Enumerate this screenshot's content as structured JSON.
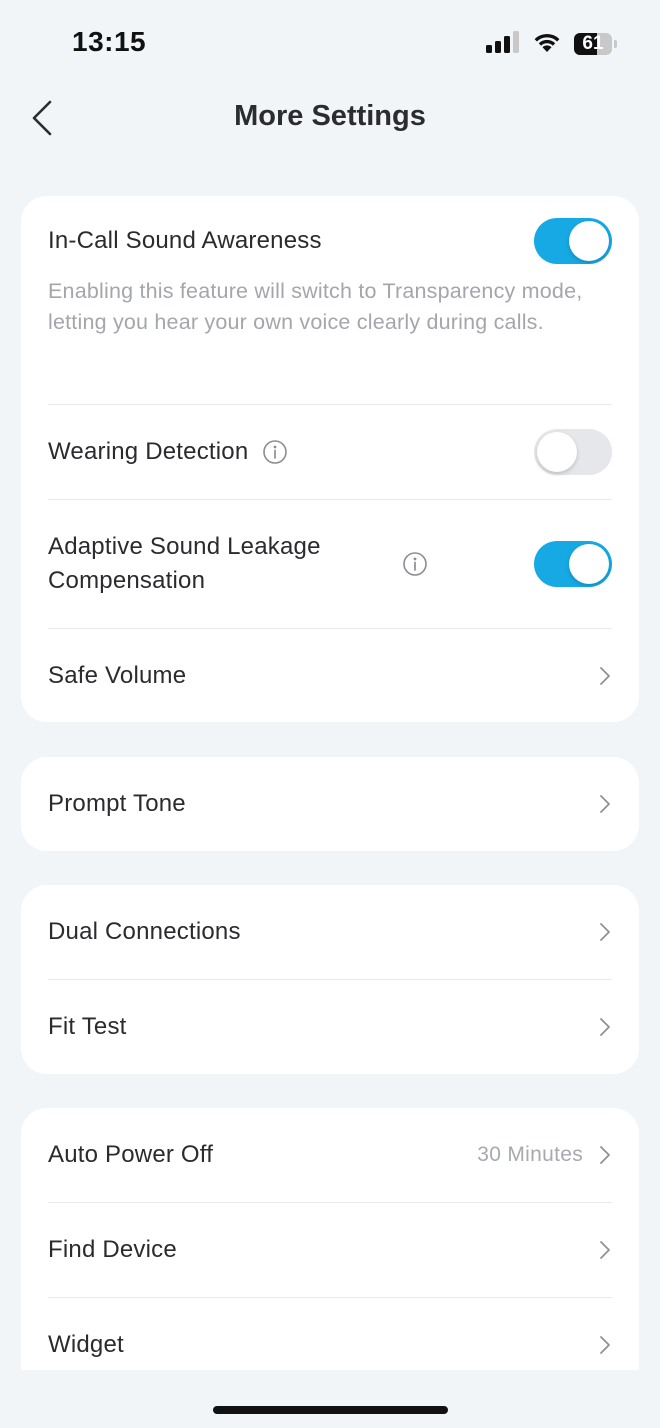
{
  "status_bar": {
    "time": "13:15",
    "battery_level": "61",
    "battery_fraction": 0.61
  },
  "nav": {
    "title": "More Settings"
  },
  "colors": {
    "accent": "#16a9e4",
    "background": "#f2f5f8",
    "card": "#ffffff",
    "secondary_text": "#a3a6ab"
  },
  "card1": {
    "in_call": {
      "label": "In-Call Sound Awareness",
      "description": "Enabling this feature will switch to Transparency mode, letting you hear your own voice clearly during calls.",
      "enabled": true
    },
    "wearing_detection": {
      "label": "Wearing Detection",
      "enabled": false,
      "icon": "info-icon"
    },
    "adaptive_leakage": {
      "label": "Adaptive Sound Leakage Compensation",
      "enabled": true,
      "icon": "info-icon"
    },
    "safe_volume": {
      "label": "Safe Volume"
    }
  },
  "card2": {
    "prompt_tone": {
      "label": "Prompt Tone"
    }
  },
  "card3": {
    "dual_connections": {
      "label": "Dual Connections"
    },
    "fit_test": {
      "label": "Fit Test"
    }
  },
  "card4": {
    "auto_power_off": {
      "label": "Auto Power Off",
      "value": "30 Minutes"
    },
    "find_device": {
      "label": "Find Device"
    },
    "widget": {
      "label": "Widget"
    }
  }
}
